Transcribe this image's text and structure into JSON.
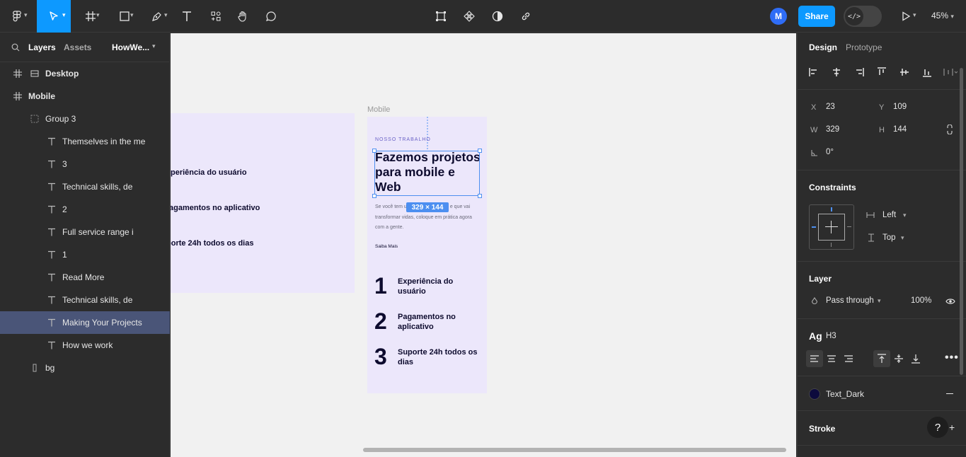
{
  "toolbar": {
    "icons": [
      "figma-menu-icon",
      "move-tool-icon",
      "frame-tool-icon",
      "shape-tool-icon",
      "pen-tool-icon",
      "text-tool-icon",
      "resources-icon",
      "hand-tool-icon",
      "comment-tool-icon",
      "crop-icon",
      "component-icon",
      "mask-icon",
      "link-icon",
      "play-icon"
    ],
    "avatar_initial": "M",
    "share_label": "Share",
    "dev_mode_glyph": "</>",
    "zoom_label": "45%"
  },
  "left_panel": {
    "tabs": {
      "layers": "Layers",
      "assets": "Assets",
      "page": "HowWe..."
    },
    "layers": [
      {
        "label": "Desktop",
        "icon": "frame-icon",
        "level": 0,
        "bold": true
      },
      {
        "label": "Mobile",
        "icon": "frame-icon",
        "level": 0,
        "bold": true
      },
      {
        "label": "Group 3",
        "icon": "group-icon",
        "level": 1
      },
      {
        "label": "Themselves in the me",
        "icon": "text-icon",
        "level": 2
      },
      {
        "label": "3",
        "icon": "text-icon",
        "level": 2
      },
      {
        "label": "Technical skills, de",
        "icon": "text-icon",
        "level": 2
      },
      {
        "label": "2",
        "icon": "text-icon",
        "level": 2
      },
      {
        "label": "Full service range i",
        "icon": "text-icon",
        "level": 2
      },
      {
        "label": "1",
        "icon": "text-icon",
        "level": 2
      },
      {
        "label": "Read More",
        "icon": "text-icon",
        "level": 2
      },
      {
        "label": "Technical skills, de",
        "icon": "text-icon",
        "level": 2
      },
      {
        "label": "Making Your Projects",
        "icon": "text-icon",
        "level": 2,
        "selected": true
      },
      {
        "label": "How we work",
        "icon": "text-icon",
        "level": 2
      },
      {
        "label": "bg",
        "icon": "rectangle-icon",
        "level": 1
      }
    ]
  },
  "canvas": {
    "desktop_frame_items": [
      "periência do usuário",
      "agamentos no aplicativo",
      "porte 24h todos os dias"
    ],
    "mobile_label": "Mobile",
    "eyebrow": "NOSSO TRABALHO",
    "heading": "Fazemos projetos para mobile e Web",
    "dimension_badge": "329 × 144",
    "paragraph": "Se você tem uma ideia inovadora e que vai transformar vidas, coloque em prática agora com a gente.",
    "link_text": "Saiba Mais",
    "steps": [
      {
        "number": "1",
        "text": "Experiência do usuário"
      },
      {
        "number": "2",
        "text": "Pagamentos no aplicativo"
      },
      {
        "number": "3",
        "text": "Suporte 24h todos os dias"
      }
    ]
  },
  "right_panel": {
    "tabs": {
      "design": "Design",
      "prototype": "Prototype"
    },
    "position": {
      "x_label": "X",
      "x": "23",
      "y_label": "Y",
      "y": "109",
      "w_label": "W",
      "w": "329",
      "h_label": "H",
      "h": "144",
      "rotation": "0°"
    },
    "constraints": {
      "title": "Constraints",
      "horizontal": "Left",
      "vertical": "Top"
    },
    "layer": {
      "title": "Layer",
      "blend": "Pass through",
      "opacity": "100%"
    },
    "typography": {
      "style_glyph": "Ag",
      "style_name": "H3"
    },
    "fill": {
      "name": "Text_Dark",
      "color": "#0d0b3d"
    },
    "stroke": {
      "title": "Stroke"
    },
    "help_label": "?"
  },
  "colors": {
    "accent": "#0d99ff",
    "selection": "#4d8ff0",
    "frame_bg": "#ece7fb",
    "text_dark": "#0d0b2e"
  }
}
